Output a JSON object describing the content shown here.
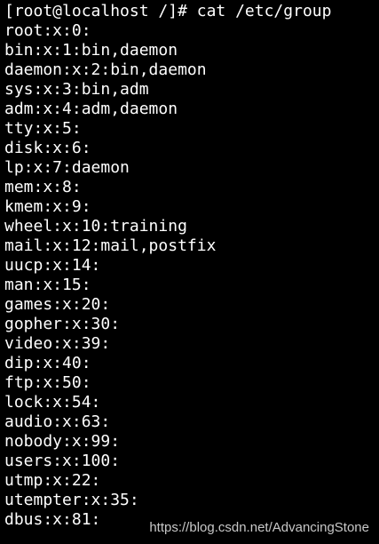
{
  "terminal": {
    "prompt_line": "[root@localhost /]# cat /etc/group",
    "output_lines": [
      "root:x:0:",
      "bin:x:1:bin,daemon",
      "daemon:x:2:bin,daemon",
      "sys:x:3:bin,adm",
      "adm:x:4:adm,daemon",
      "tty:x:5:",
      "disk:x:6:",
      "lp:x:7:daemon",
      "mem:x:8:",
      "kmem:x:9:",
      "wheel:x:10:training",
      "mail:x:12:mail,postfix",
      "uucp:x:14:",
      "man:x:15:",
      "games:x:20:",
      "gopher:x:30:",
      "video:x:39:",
      "dip:x:40:",
      "ftp:x:50:",
      "lock:x:54:",
      "audio:x:63:",
      "nobody:x:99:",
      "users:x:100:",
      "utmp:x:22:",
      "utempter:x:35:",
      "dbus:x:81:"
    ]
  },
  "watermark": {
    "text": "https://blog.csdn.net/AdvancingStone"
  },
  "colors": {
    "background": "#000000",
    "text": "#ffffff",
    "watermark": "#c8c8c8"
  }
}
